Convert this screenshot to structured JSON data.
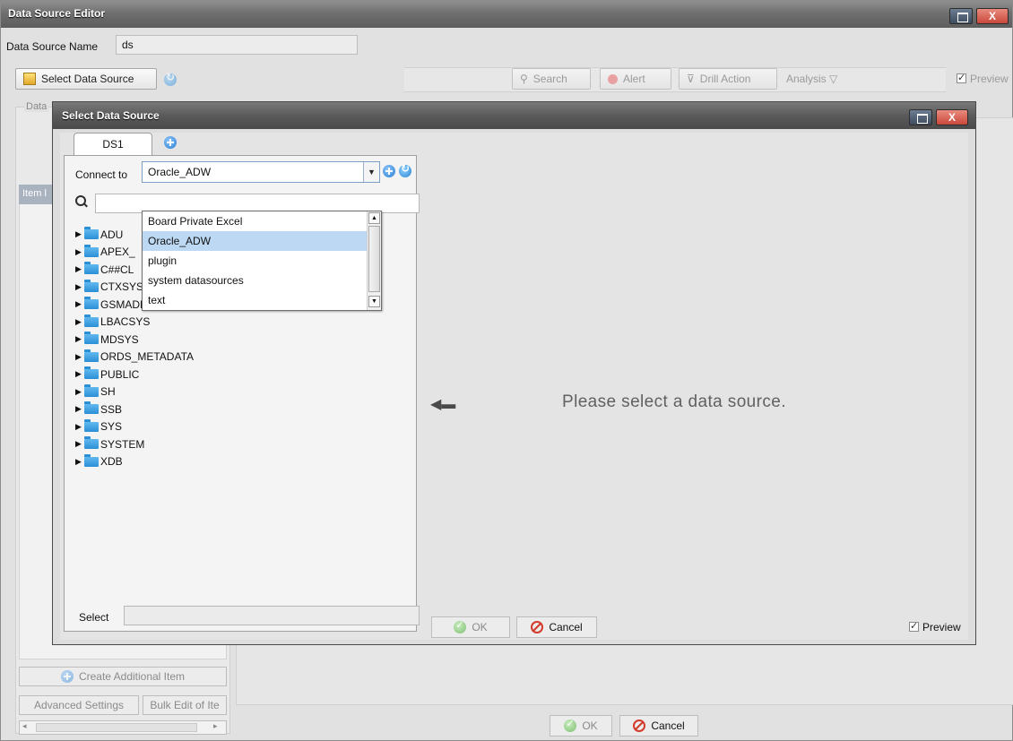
{
  "window": {
    "title": "Data Source Editor",
    "close_label": "X"
  },
  "data_source_name": {
    "label": "Data Source Name",
    "value": "ds"
  },
  "toolbar": {
    "select_data_source": "Select Data Source",
    "search": "Search",
    "alert": "Alert",
    "drill_action": "Drill Action",
    "analysis": "Analysis ▽",
    "preview": "Preview"
  },
  "left_panel": {
    "group_label": "Data",
    "list_header": "Item l",
    "create_additional_item": "Create Additional Item",
    "advanced_settings": "Advanced Settings",
    "bulk_edit": "Bulk Edit of Ite"
  },
  "footer": {
    "ok": "OK",
    "cancel": "Cancel"
  },
  "modal": {
    "title": "Select Data Source",
    "close_label": "X",
    "tab_label": "DS1",
    "connect_to_label": "Connect to",
    "connect_to_value": "Oracle_ADW",
    "dropdown_options": [
      {
        "label": "Board Private Excel",
        "selected": false
      },
      {
        "label": "Oracle_ADW",
        "selected": true
      },
      {
        "label": "plugin",
        "selected": false
      },
      {
        "label": "system datasources",
        "selected": false
      },
      {
        "label": "text",
        "selected": false
      }
    ],
    "tree_items": [
      "ADU",
      "APEX_",
      "C##CL",
      "CTXSYS",
      "GSMADMIN_INTERNAL",
      "LBACSYS",
      "MDSYS",
      "ORDS_METADATA",
      "PUBLIC",
      "SH",
      "SSB",
      "SYS",
      "SYSTEM",
      "XDB"
    ],
    "select_label": "Select",
    "placeholder_message": "Please select a data source.",
    "ok": "OK",
    "cancel": "Cancel",
    "preview": "Preview"
  }
}
